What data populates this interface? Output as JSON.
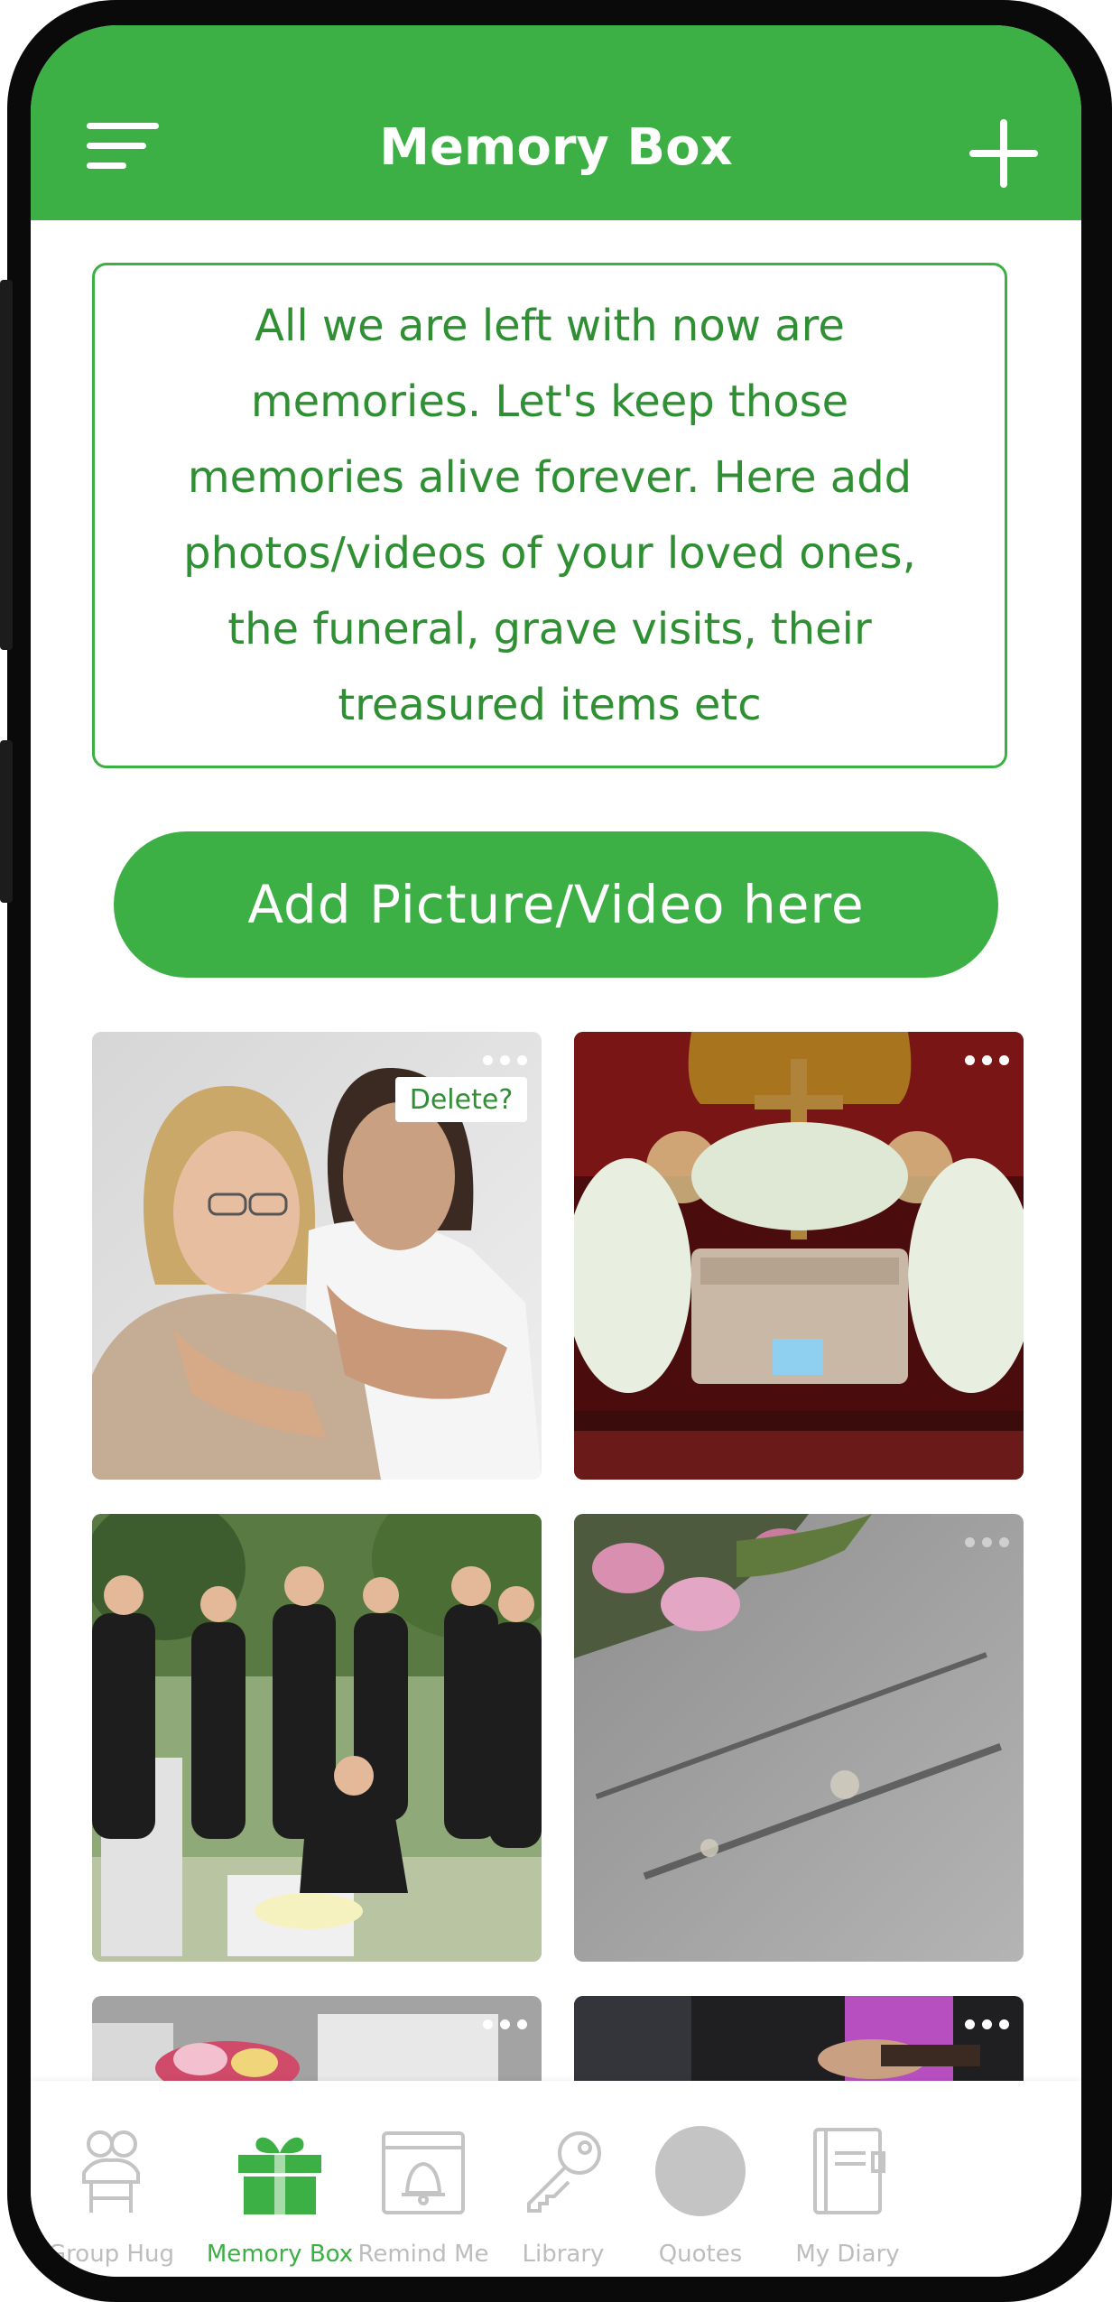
{
  "header": {
    "title": "Memory Box"
  },
  "intro": {
    "text": "All we are left with now are memories. Let's keep those memories alive forever. Here add photos/videos of your loved ones, the funeral, grave visits, their treasured items etc"
  },
  "add_button": {
    "label": "Add Picture/Video here"
  },
  "gallery": {
    "delete_label": "Delete?"
  },
  "nav": {
    "items": [
      {
        "label": "Group Hug",
        "icon": "group-hug-icon"
      },
      {
        "label": "Memory Box",
        "icon": "gift-box-icon"
      },
      {
        "label": "Remind Me",
        "icon": "calendar-bell-icon"
      },
      {
        "label": "Library",
        "icon": "key-icon"
      },
      {
        "label": "Quotes",
        "icon": "quotes-circle-icon"
      },
      {
        "label": "My Diary",
        "icon": "diary-icon"
      }
    ]
  },
  "colors": {
    "brand_green": "#3cb044",
    "text_green": "#2f8f33",
    "inactive_gray": "#bdbdbd"
  }
}
